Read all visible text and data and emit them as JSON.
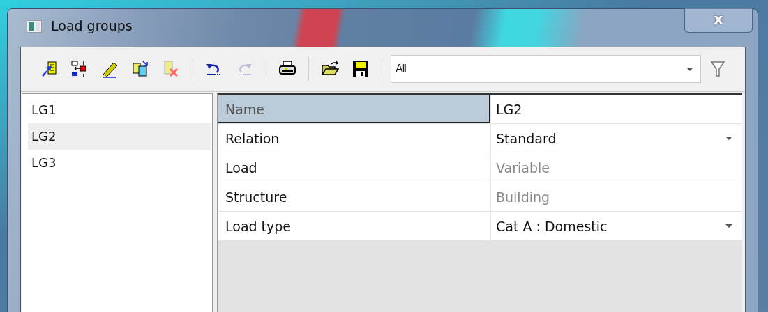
{
  "window": {
    "title": "Load groups",
    "close_label": "x"
  },
  "toolbar": {
    "groups": [
      [
        {
          "kind": "new",
          "disabled": false
        },
        {
          "kind": "arrange",
          "disabled": false
        },
        {
          "kind": "edit",
          "disabled": false
        },
        {
          "kind": "copy",
          "disabled": false
        },
        {
          "kind": "delete",
          "disabled": false
        }
      ],
      [
        {
          "kind": "undo",
          "disabled": false
        },
        {
          "kind": "redo",
          "disabled": true
        }
      ],
      [
        {
          "kind": "print",
          "disabled": false
        }
      ],
      [
        {
          "kind": "open",
          "disabled": false
        },
        {
          "kind": "save",
          "disabled": false
        }
      ]
    ],
    "filter": {
      "value": "All"
    }
  },
  "list": {
    "items": [
      {
        "label": "LG1",
        "selected": false
      },
      {
        "label": "LG2",
        "selected": true
      },
      {
        "label": "LG3",
        "selected": false
      }
    ]
  },
  "properties": {
    "rows": [
      {
        "label": "Name",
        "value": "LG2",
        "selected": true,
        "readonly": false,
        "kind": "text"
      },
      {
        "label": "Relation",
        "value": "Standard",
        "selected": false,
        "readonly": false,
        "kind": "dropdown"
      },
      {
        "label": "Load",
        "value": "Variable",
        "selected": false,
        "readonly": true,
        "kind": "text"
      },
      {
        "label": "Structure",
        "value": "Building",
        "selected": false,
        "readonly": true,
        "kind": "text"
      },
      {
        "label": "Load type",
        "value": "Cat A : Domestic",
        "selected": false,
        "readonly": false,
        "kind": "dropdown"
      }
    ]
  }
}
